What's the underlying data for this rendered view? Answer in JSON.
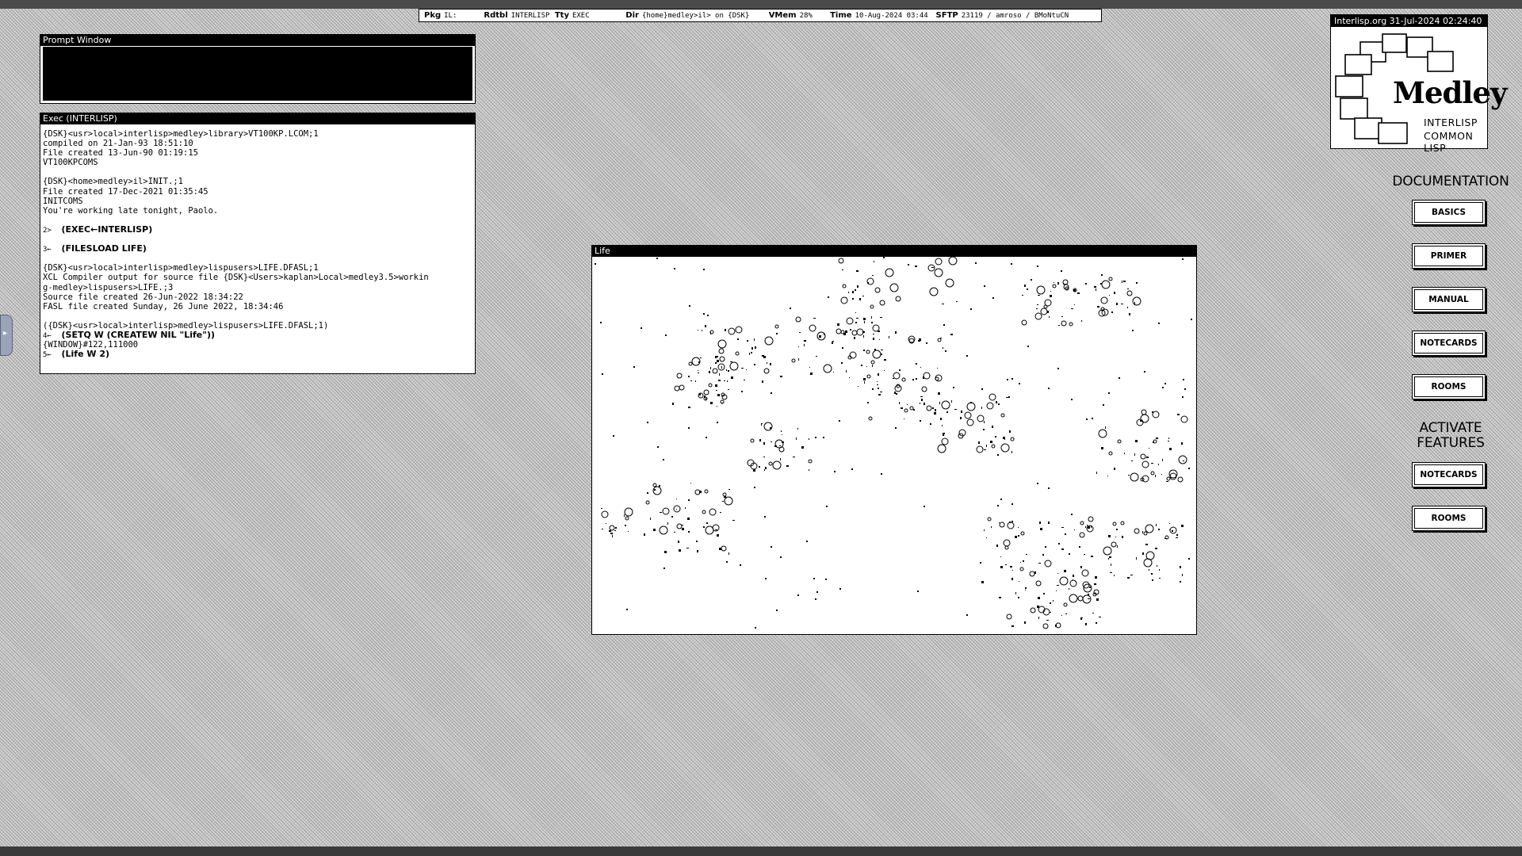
{
  "status_bar": {
    "pkg_label": "Pkg",
    "pkg_value": "IL:",
    "rdtbl_label": "Rdtbl",
    "rdtbl_value": "INTERLISP",
    "tty_label": "Tty",
    "tty_value": "EXEC",
    "dir_label": "Dir",
    "dir_value": "{home}medley>il> on {DSK}",
    "vmem_label": "VMem",
    "vmem_value": "28%",
    "time_label": "Time",
    "time_value": "10-Aug-2024 03:44",
    "sftp_label": "SFTP",
    "sftp_value": "23119 / amroso / BMoNtuCN"
  },
  "prompt_window": {
    "title": "Prompt Window"
  },
  "exec_window": {
    "title": "Exec (INTERLISP)",
    "lines": [
      {
        "t": "{DSK}<usr>local>interlisp>medley>library>VT100KP.LCOM;1"
      },
      {
        "t": "compiled on 21-Jan-93 18:51:10"
      },
      {
        "t": "File created 13-Jun-90 01:19:15"
      },
      {
        "t": "VT100KPCOMS"
      },
      {
        "t": ""
      },
      {
        "t": "{DSK}<home>medley>il>INIT.;1"
      },
      {
        "t": "File created 17-Dec-2021 01:35:45"
      },
      {
        "t": "INITCOMS"
      },
      {
        "t": "You're working late tonight, Paolo."
      },
      {
        "t": ""
      },
      {
        "p": "2>",
        "c": "(EXEC←INTERLISP)"
      },
      {
        "t": ""
      },
      {
        "p": "3←",
        "c": "(FILESLOAD LIFE)"
      },
      {
        "t": ""
      },
      {
        "t": "{DSK}<usr>local>interlisp>medley>lispusers>LIFE.DFASL;1"
      },
      {
        "t": "XCL Compiler output for source file {DSK}<Users>kaplan>Local>medley3.5>workin"
      },
      {
        "t": "g-medley>lispusers>LIFE.;3"
      },
      {
        "t": "Source file created 26-Jun-2022 18:34:22"
      },
      {
        "t": "FASL file created Sunday, 26 June 2022, 18:34:46"
      },
      {
        "t": ""
      },
      {
        "t": "({DSK}<usr>local>interlisp>medley>lispusers>LIFE.DFASL;1)"
      },
      {
        "p": "4←",
        "c": "(SETQ W (CREATEW NIL \"Life\"))"
      },
      {
        "t": "{WINDOW}#122,111000"
      },
      {
        "p": "5←",
        "c": "(Life W 2)"
      }
    ]
  },
  "life_window": {
    "title": "Life"
  },
  "logo": {
    "title": "Interlisp.org 31-Jul-2024 02:24:40",
    "name": "Medley",
    "line1": "INTERLISP",
    "line2": "COMMON LISP"
  },
  "documentation": {
    "heading": "DOCUMENTATION",
    "buttons": [
      "BASICS",
      "PRIMER",
      "MANUAL",
      "NOTECARDS",
      "ROOMS"
    ]
  },
  "activate": {
    "heading_line1": "ACTIVATE",
    "heading_line2": "FEATURES",
    "buttons": [
      "NOTECARDS",
      "ROOMS"
    ]
  },
  "icons": {
    "logo_mark": "medley-boxes-logo",
    "side_tab": "chevron-right-icon"
  },
  "colors": {
    "foreground": "#000000",
    "background": "#ffffff",
    "desktop": "#c8c8c8"
  }
}
